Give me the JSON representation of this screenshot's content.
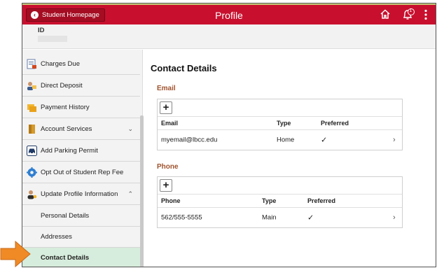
{
  "header": {
    "back_label": "Student Homepage",
    "title": "Profile",
    "notification_count": "1"
  },
  "idbar": {
    "label": "ID"
  },
  "sidebar": {
    "items": [
      {
        "label": "Charges Due"
      },
      {
        "label": "Direct Deposit"
      },
      {
        "label": "Payment History"
      },
      {
        "label": "Account Services"
      },
      {
        "label": "Add Parking Permit"
      },
      {
        "label": "Opt Out of Student Rep Fee"
      },
      {
        "label": "Update Profile Information"
      },
      {
        "label": "Personal Details"
      },
      {
        "label": "Addresses"
      },
      {
        "label": "Contact Details"
      }
    ]
  },
  "main": {
    "title": "Contact Details",
    "email": {
      "section_title": "Email",
      "columns": [
        "Email",
        "Type",
        "Preferred"
      ],
      "rows": [
        {
          "value": "myemail@lbcc.edu",
          "type": "Home"
        }
      ]
    },
    "phone": {
      "section_title": "Phone",
      "columns": [
        "Phone",
        "Type",
        "Preferred"
      ],
      "rows": [
        {
          "value": "562/555-5555",
          "type": "Main"
        }
      ]
    }
  },
  "colors": {
    "header": "#c8102e",
    "section_title": "#a0522d",
    "active_item": "#d6ecdc",
    "pointer_arrow": "#f08a24"
  }
}
